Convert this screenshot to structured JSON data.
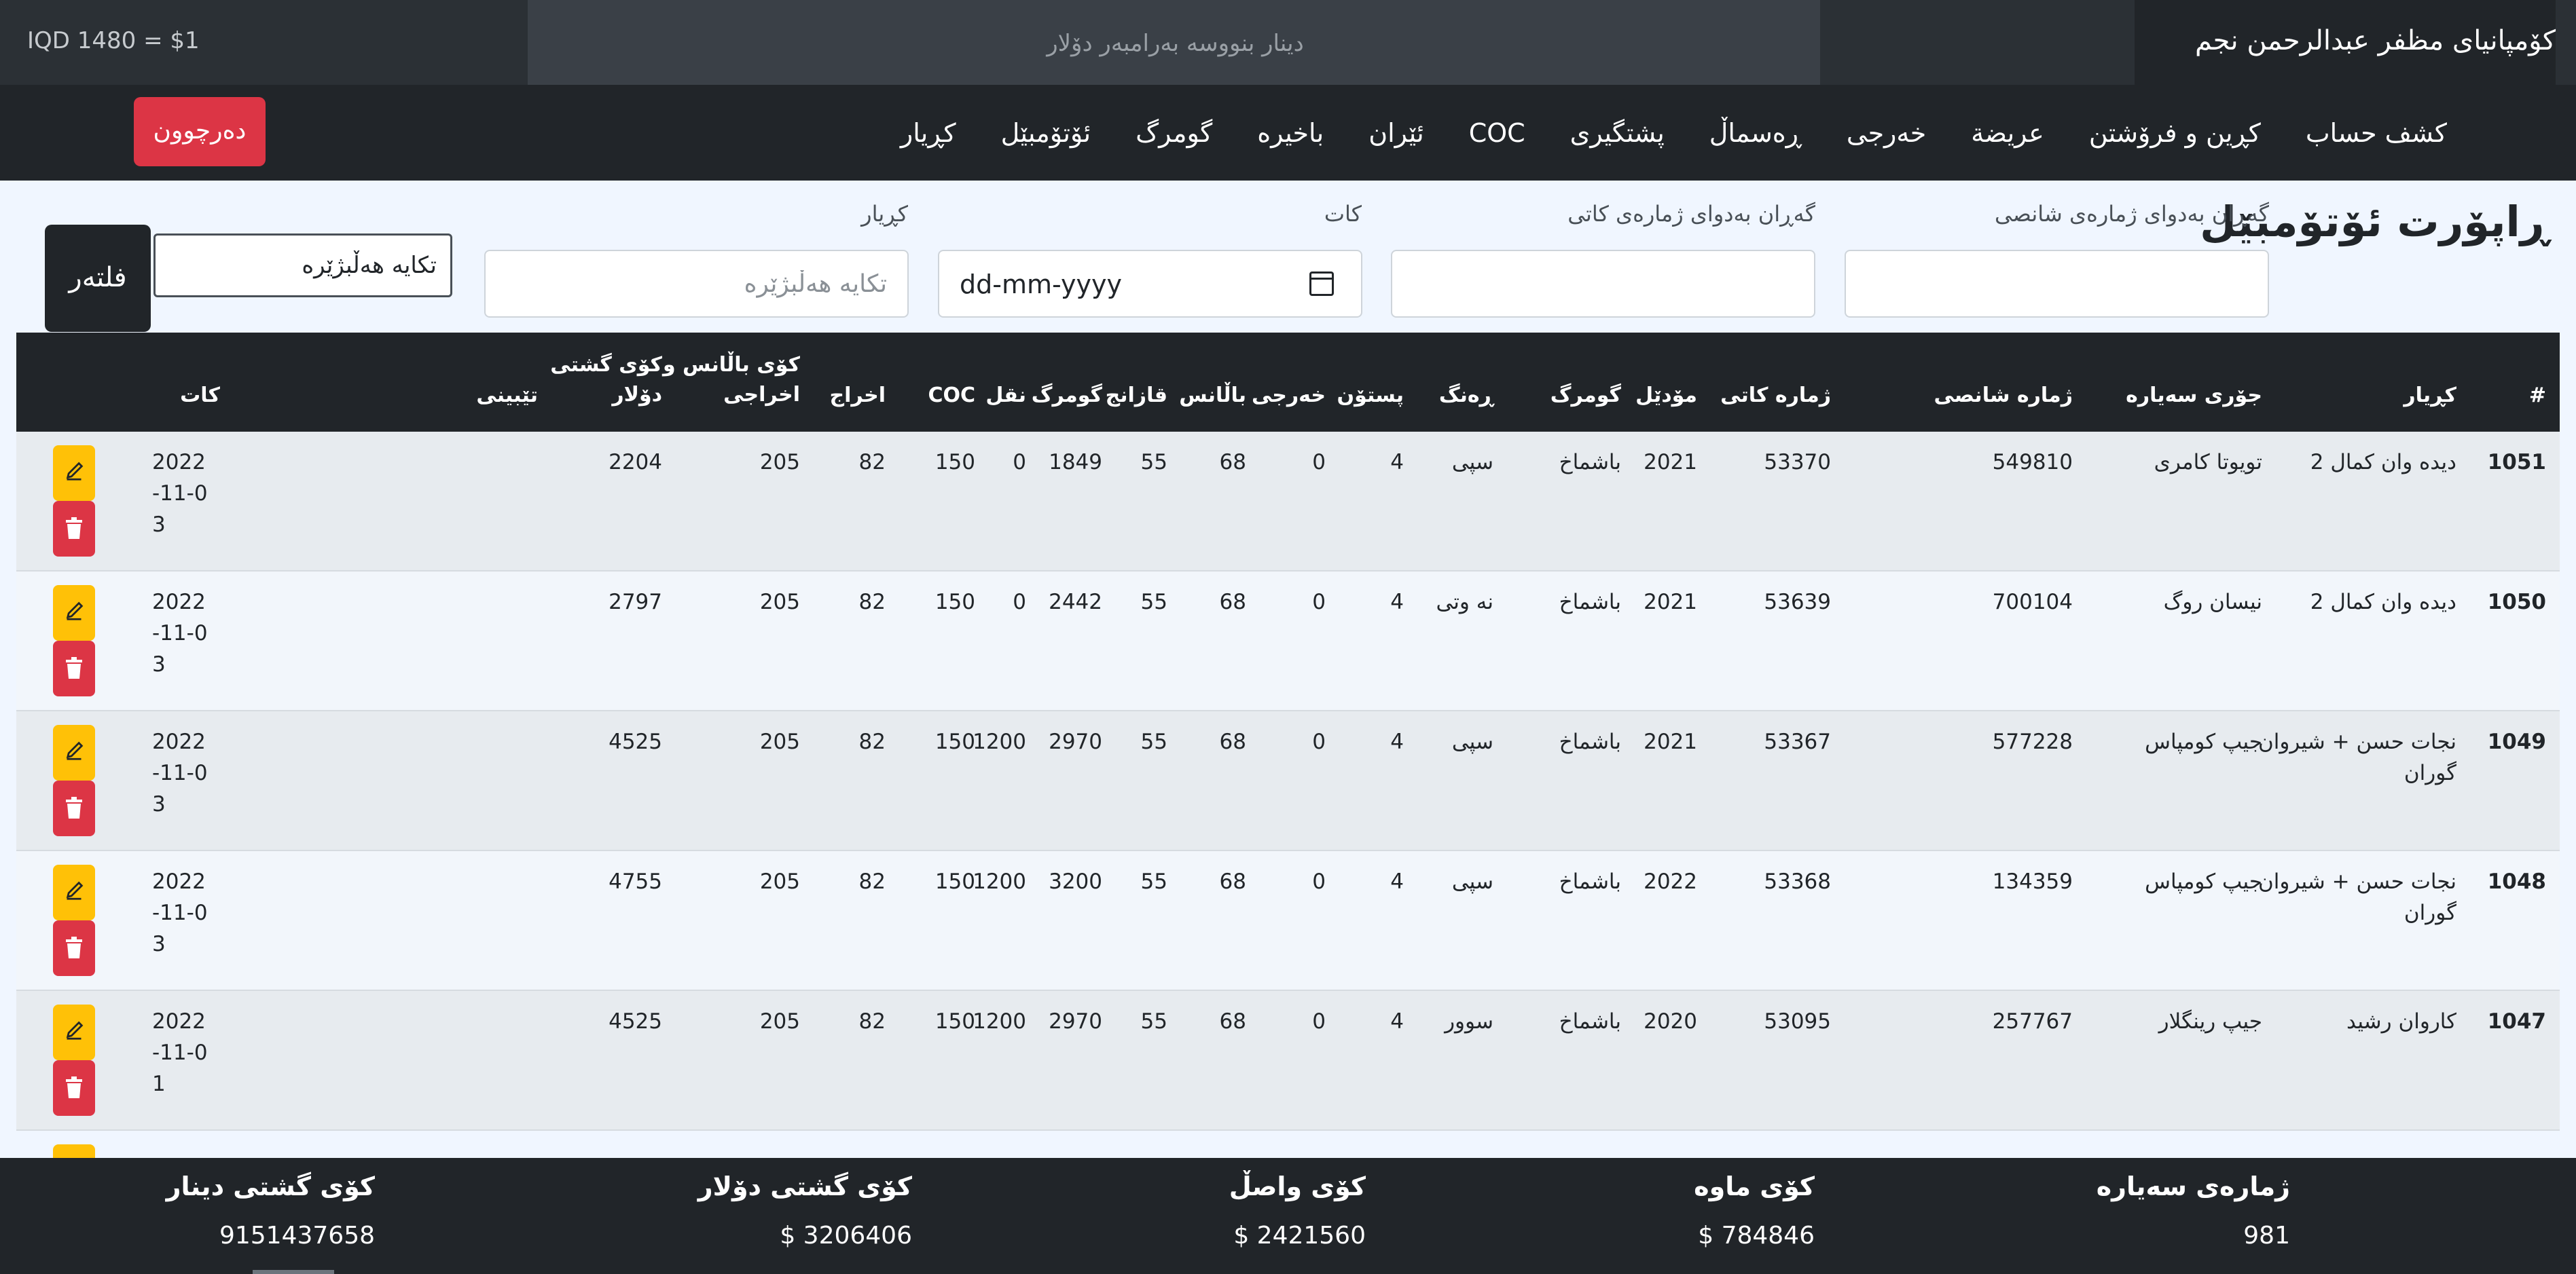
{
  "topbar": {
    "rate": "IQD 1480 = $1",
    "converter_placeholder": "دینار بنووسە بەرامبەر دۆلار",
    "company": "کۆمپانیای مظفر عبدالرحمن نجم"
  },
  "nav": {
    "items": [
      "کڕیار",
      "ئۆتۆمبێل",
      "گومرگ",
      "باخیرە",
      "ئێران",
      "COC",
      "پشتگیری",
      "ڕەسماڵ",
      "خەرجی",
      "عریضة",
      "کڕین و فرۆشتن",
      "کشف حساب"
    ],
    "logout": "دەرچوون"
  },
  "filters": {
    "title": "ڕاپۆرت ئۆتۆمبێل",
    "chassis_label": "گەڕان بەدوای ژمارەی شانصی",
    "plate_label": "گەڕان بەدوای ژمارەی کاتی",
    "date_label": "کات",
    "date_value": "dd-mm-yyyy",
    "customer_label": "کڕیار",
    "customer_placeholder": "تکایە هەڵبژێرە",
    "select_value": "تکایە هەڵبژێرە",
    "filter_button": "فلتەر"
  },
  "table": {
    "headers": {
      "num": "#",
      "customer": "کڕیار",
      "car_type": "جۆری سەیارە",
      "chassis": "ژمارە شانصی",
      "plate": "ژمارە کاتی",
      "model": "مۆدێل",
      "customs": "گومرگ",
      "color": "ڕەنگ",
      "post": "پستۆن",
      "expense": "خەرجی",
      "balance": "باڵانس",
      "garage": "قازانج",
      "customs_fee": "گومرگ",
      "transport": "نقل",
      "coc": "COC",
      "exit": "اخراج",
      "total_balance_l1": "کۆی باڵانس و",
      "total_balance_l2": "اخراجی",
      "total_usd_l1": "کۆی گشتی",
      "total_usd_l2": "دۆلار",
      "note": "تێبینی",
      "date": "کات"
    },
    "rows": [
      {
        "num": "1051",
        "customer": "دیدە وان کمال 2",
        "car_type": "تویوتا کامری",
        "chassis": "549810",
        "plate": "53370",
        "model": "2021",
        "customs": "باشماخ",
        "color": "سپی",
        "post": "4",
        "expense": "0",
        "balance": "68",
        "garage": "55",
        "customs_fee": "1849",
        "transport": "0",
        "coc": "150",
        "exit": "82",
        "total_balance": "205",
        "total_usd": "2204",
        "note": "",
        "date": "2022-11-03"
      },
      {
        "num": "1050",
        "customer": "دیدە وان کمال 2",
        "car_type": "نیسان روگ",
        "chassis": "700104",
        "plate": "53639",
        "model": "2021",
        "customs": "باشماخ",
        "color": "نە وتی",
        "post": "4",
        "expense": "0",
        "balance": "68",
        "garage": "55",
        "customs_fee": "2442",
        "transport": "0",
        "coc": "150",
        "exit": "82",
        "total_balance": "205",
        "total_usd": "2797",
        "note": "",
        "date": "2022-11-03"
      },
      {
        "num": "1049",
        "customer": "نجات حسن + شیروان گوران",
        "car_type": "جیپ کومپاس",
        "chassis": "577228",
        "plate": "53367",
        "model": "2021",
        "customs": "باشماخ",
        "color": "سپی",
        "post": "4",
        "expense": "0",
        "balance": "68",
        "garage": "55",
        "customs_fee": "2970",
        "transport": "1200",
        "coc": "150",
        "exit": "82",
        "total_balance": "205",
        "total_usd": "4525",
        "note": "",
        "date": "2022-11-03"
      },
      {
        "num": "1048",
        "customer": "نجات حسن + شیروان گوران",
        "car_type": "جیپ کومپاس",
        "chassis": "134359",
        "plate": "53368",
        "model": "2022",
        "customs": "باشماخ",
        "color": "سپی",
        "post": "4",
        "expense": "0",
        "balance": "68",
        "garage": "55",
        "customs_fee": "3200",
        "transport": "1200",
        "coc": "150",
        "exit": "82",
        "total_balance": "205",
        "total_usd": "4755",
        "note": "",
        "date": "2022-11-03"
      },
      {
        "num": "1047",
        "customer": "کاروان رشید",
        "car_type": "جیپ رینگلار",
        "chassis": "257767",
        "plate": "53095",
        "model": "2020",
        "customs": "باشماخ",
        "color": "سوور",
        "post": "4",
        "expense": "0",
        "balance": "68",
        "garage": "55",
        "customs_fee": "2970",
        "transport": "1200",
        "coc": "150",
        "exit": "82",
        "total_balance": "205",
        "total_usd": "4525",
        "note": "",
        "date": "2022-11-01"
      }
    ]
  },
  "footer": {
    "car_count_label": "ژمارەی سەیارە",
    "car_count": "981",
    "remaining_label": "کۆی ماوە",
    "remaining": "$ 784846",
    "received_label": "کۆی واصڵ",
    "received": "$ 2421560",
    "total_usd_label": "کۆی گشتی دۆلار",
    "total_usd": "$ 3206406",
    "total_iqd_label": "کۆی گشتی دینار",
    "total_iqd": "9151437658"
  },
  "colors": {
    "dark": "#212529",
    "danger": "#dc3545",
    "warning": "#ffc107"
  }
}
